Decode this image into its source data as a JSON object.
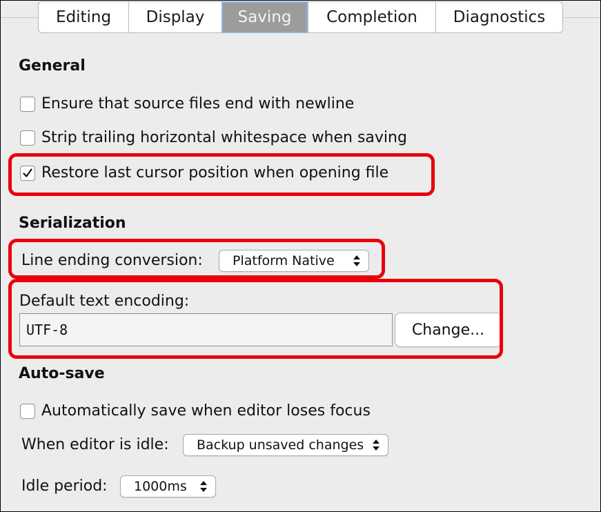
{
  "tabs": [
    {
      "label": "Editing"
    },
    {
      "label": "Display"
    },
    {
      "label": "Saving"
    },
    {
      "label": "Completion"
    },
    {
      "label": "Diagnostics"
    }
  ],
  "active_tab": "Saving",
  "general": {
    "heading": "General",
    "ensure_newline": {
      "label": "Ensure that source files end with newline",
      "checked": false
    },
    "strip_whitespace": {
      "label": "Strip trailing horizontal whitespace when saving",
      "checked": false
    },
    "restore_cursor": {
      "label": "Restore last cursor position when opening file",
      "checked": true
    }
  },
  "serialization": {
    "heading": "Serialization",
    "line_ending_label": "Line ending conversion:",
    "line_ending_value": "Platform Native",
    "encoding_label": "Default text encoding:",
    "encoding_value": "UTF-8",
    "change_button": "Change..."
  },
  "autosave": {
    "heading": "Auto-save",
    "focus": {
      "label": "Automatically save when editor loses focus",
      "checked": false
    },
    "idle_label": "When editor is idle:",
    "idle_value": "Backup unsaved changes",
    "period_label": "Idle period:",
    "period_value": "1000ms"
  },
  "colors": {
    "highlight": "#e8000b",
    "active_tab_bg": "#9c9c9c",
    "active_tab_border": "#8fb3e8"
  },
  "icons": {
    "checkmark": "checkmark-icon",
    "select_arrows": "chevron-updown-icon"
  }
}
